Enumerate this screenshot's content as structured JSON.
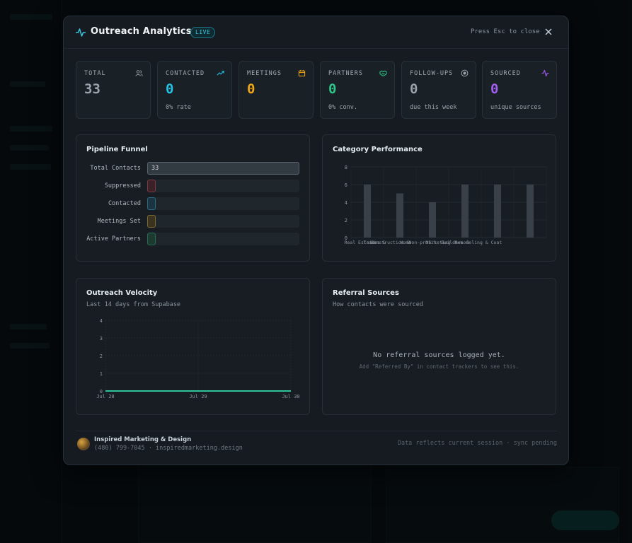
{
  "modal": {
    "title": "Outreach Analytics",
    "badge": "LIVE",
    "close_hint": "Press Esc to close"
  },
  "stats": [
    {
      "label": "TOTAL",
      "value": "33",
      "sub": "",
      "color": "#9aa3ab",
      "icon": "users-icon"
    },
    {
      "label": "CONTACTED",
      "value": "0",
      "sub": "0% rate",
      "color": "#22c3e6",
      "icon": "trending-up-icon"
    },
    {
      "label": "MEETINGS",
      "value": "0",
      "sub": "",
      "color": "#f0a516",
      "icon": "calendar-icon"
    },
    {
      "label": "PARTNERS",
      "value": "0",
      "sub": "0% conv.",
      "color": "#2fc58a",
      "icon": "handshake-icon"
    },
    {
      "label": "FOLLOW-UPS",
      "value": "0",
      "sub": "due this week",
      "color": "#9aa3ab",
      "icon": "clock-icon"
    },
    {
      "label": "SOURCED",
      "value": "0",
      "sub": "unique sources",
      "color": "#a25ef0",
      "icon": "activity-icon"
    }
  ],
  "funnel": {
    "title": "Pipeline Funnel",
    "rows": [
      {
        "label": "Total Contacts",
        "value": "33",
        "fraction": 1.0,
        "color": "#5a6470",
        "bg": "#323a42"
      },
      {
        "label": "Suppressed",
        "value": "",
        "fraction": 0.0,
        "color": "#7a3b45",
        "bg": "#3a2228"
      },
      {
        "label": "Contacted",
        "value": "",
        "fraction": 0.0,
        "color": "#2a6a85",
        "bg": "#1c3440"
      },
      {
        "label": "Meetings Set",
        "value": "",
        "fraction": 0.0,
        "color": "#7d6a2e",
        "bg": "#3a3320"
      },
      {
        "label": "Active Partners",
        "value": "",
        "fraction": 0.0,
        "color": "#2a6a55",
        "bg": "#1c3a30"
      }
    ]
  },
  "category": {
    "title": "Category Performance"
  },
  "velocity": {
    "title": "Outreach Velocity",
    "subtitle": "Last 14 days from Supabase"
  },
  "referral": {
    "title": "Referral Sources",
    "subtitle": "How contacts were sourced",
    "empty_main": "No referral sources logged yet.",
    "empty_sub": "Add \"Referred By\" in contact trackers to see this."
  },
  "footer": {
    "brand": "Inspired Marketing & Design",
    "contact": "(480) 799-7045 · inspiredmarketing.design",
    "note": "Data reflects current session · sync pending"
  },
  "chart_data": [
    {
      "type": "bar",
      "categories": [
        "Real Estate",
        "Trades & Contractors",
        "Construction & Home",
        "Marketing",
        "Non-profit & Builders",
        "Remodeling & Coatings"
      ],
      "category_labels_visible": [
        "Real Estate",
        "Trades &",
        "Construction &",
        "Home",
        "Non-profit",
        "Marketing",
        "Builders &",
        "Remodeling & Coat"
      ],
      "values": [
        6,
        5,
        4,
        6,
        6,
        6
      ],
      "yticks": [
        0,
        2,
        4,
        6,
        8
      ],
      "ylim": [
        0,
        8
      ],
      "color": "#3a4048"
    },
    {
      "type": "line",
      "x_ticks": [
        "Jul 28",
        "Jul 29",
        "Jul 30"
      ],
      "yticks": [
        0,
        1,
        2,
        3,
        4
      ],
      "ylim": [
        0,
        4
      ],
      "series": [
        {
          "values": [
            0,
            0,
            0,
            0,
            0,
            0,
            0,
            0,
            0,
            0,
            0,
            0,
            0,
            0
          ],
          "color": "#2fc59a"
        }
      ]
    }
  ]
}
